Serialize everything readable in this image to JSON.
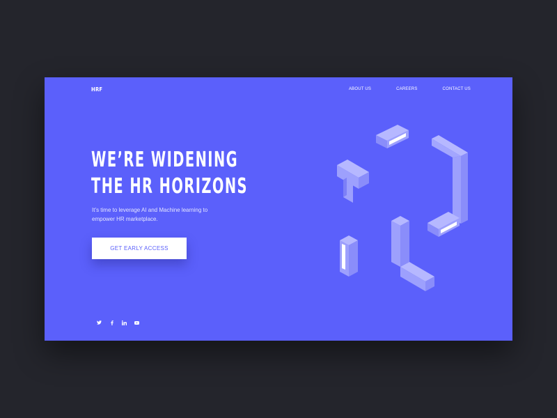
{
  "brand": {
    "logo": "HRF"
  },
  "nav": {
    "items": [
      {
        "label": "ABOUT US"
      },
      {
        "label": "CAREERS"
      },
      {
        "label": "CONTACT US"
      }
    ]
  },
  "hero": {
    "headline_line1": "WE’RE WIDENING",
    "headline_line2": "THE HR HORIZONS",
    "subtext": "It’s time to leverage AI and Machine learning to empower HR marketplace.",
    "cta_label": "GET EARLY ACCESS"
  },
  "social": {
    "icons": [
      "twitter-icon",
      "facebook-icon",
      "linkedin-icon",
      "youtube-icon"
    ]
  },
  "colors": {
    "background": "#24252c",
    "hero": "#5b60fb",
    "art_light": "#b6b8ff",
    "art_mid": "#9598fb",
    "art_dark": "#7c7ff7",
    "white": "#ffffff"
  }
}
